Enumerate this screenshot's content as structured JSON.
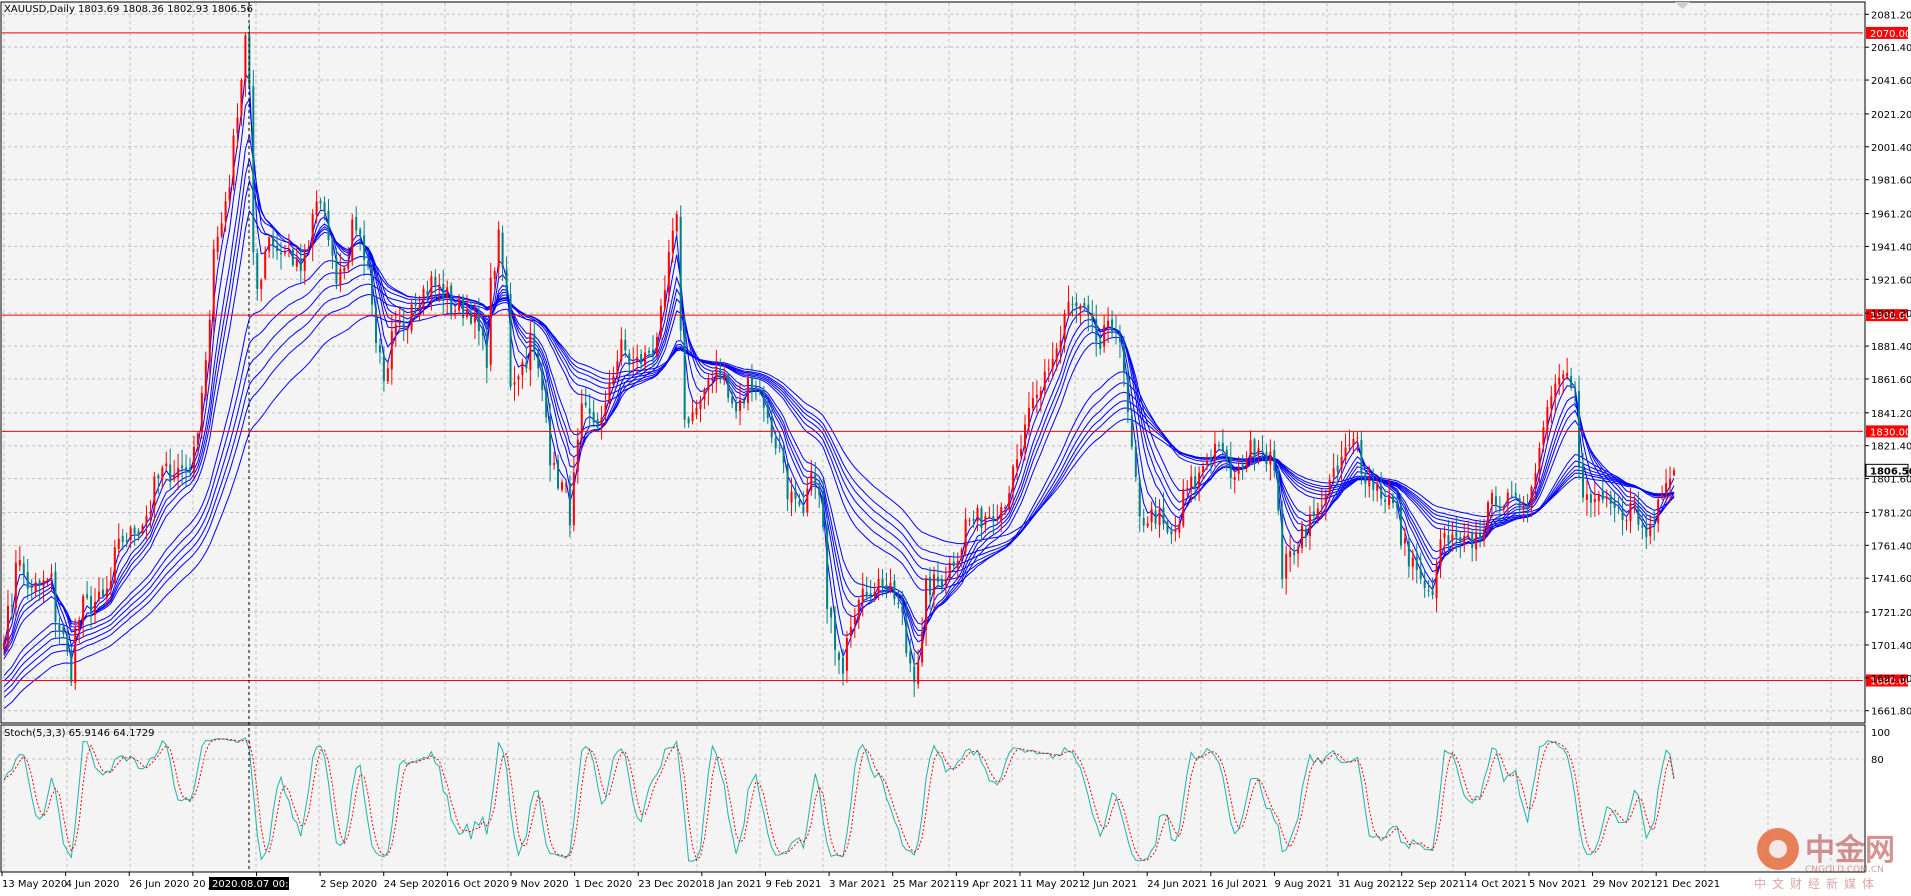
{
  "chart_data": {
    "type": "candlestick",
    "symbol_header": "XAUUSD,Daily  1803.69 1808.36 1802.93 1806.56",
    "ohlc_last": {
      "open": 1803.69,
      "high": 1808.36,
      "low": 1802.93,
      "close": 1806.56
    },
    "current_price_label": "1806.56",
    "price_axis_ticks": [
      "2081.20",
      "2061.40",
      "2041.60",
      "2021.20",
      "2001.40",
      "1981.60",
      "1961.20",
      "1941.40",
      "1921.60",
      "1901.20",
      "1881.40",
      "1861.60",
      "1841.20",
      "1821.40",
      "1801.60",
      "1781.20",
      "1761.40",
      "1741.60",
      "1721.20",
      "1701.40",
      "1681.60",
      "1661.80"
    ],
    "horizontal_levels": [
      {
        "label": "2070.00",
        "value": 2070,
        "color": "#ff0000"
      },
      {
        "label": "1900.00",
        "value": 1900,
        "color": "#ff0000"
      },
      {
        "label": "1830.00",
        "value": 1830,
        "color": "#ff0000"
      },
      {
        "label": "1680.00",
        "value": 1680,
        "color": "#ff0000"
      }
    ],
    "crosshair_date": "2020.08.07 00:00",
    "time_axis_labels": [
      "13 May 2020",
      "4 Jun 2020",
      "26 Jun 2020",
      "20 Jul 2020",
      "",
      "2 Sep 2020",
      "24 Sep 2020",
      "16 Oct 2020",
      "9 Nov 2020",
      "1 Dec 2020",
      "23 Dec 2020",
      "18 Jan 2021",
      "9 Feb 2021",
      "3 Mar 2021",
      "25 Mar 2021",
      "19 Apr 2021",
      "11 May 2021",
      "2 Jun 2021",
      "24 Jun 2021",
      "16 Jul 2021",
      "9 Aug 2021",
      "31 Aug 2021",
      "22 Sep 2021",
      "14 Oct 2021",
      "5 Nov 2021",
      "29 Nov 2021",
      "21 Dec 2021"
    ],
    "y_range": [
      1655,
      2088
    ],
    "up_color": "#ff0000",
    "down_color": "#008080",
    "ma_color": "#0000ff",
    "price_path": [
      [
        "2020-05-13",
        1710
      ],
      [
        "2020-05-18",
        1755
      ],
      [
        "2020-05-22",
        1732
      ],
      [
        "2020-05-29",
        1740
      ],
      [
        "2020-06-03",
        1705
      ],
      [
        "2020-06-05",
        1685
      ],
      [
        "2020-06-10",
        1725
      ],
      [
        "2020-06-17",
        1728
      ],
      [
        "2020-06-24",
        1765
      ],
      [
        "2020-06-30",
        1772
      ],
      [
        "2020-07-08",
        1805
      ],
      [
        "2020-07-16",
        1808
      ],
      [
        "2020-07-20",
        1815
      ],
      [
        "2020-07-24",
        1895
      ],
      [
        "2020-07-29",
        1960
      ],
      [
        "2020-08-04",
        2020
      ],
      [
        "2020-08-06",
        2068
      ],
      [
        "2020-08-11",
        1910
      ],
      [
        "2020-08-14",
        1945
      ],
      [
        "2020-08-20",
        1935
      ],
      [
        "2020-08-26",
        1930
      ],
      [
        "2020-09-01",
        1970
      ],
      [
        "2020-09-08",
        1925
      ],
      [
        "2020-09-15",
        1955
      ],
      [
        "2020-09-21",
        1905
      ],
      [
        "2020-09-24",
        1855
      ],
      [
        "2020-09-28",
        1885
      ],
      [
        "2020-10-05",
        1910
      ],
      [
        "2020-10-12",
        1920
      ],
      [
        "2020-10-19",
        1905
      ],
      [
        "2020-10-26",
        1902
      ],
      [
        "2020-10-30",
        1875
      ],
      [
        "2020-11-04",
        1945
      ],
      [
        "2020-11-09",
        1860
      ],
      [
        "2020-11-16",
        1885
      ],
      [
        "2020-11-24",
        1805
      ],
      [
        "2020-11-30",
        1780
      ],
      [
        "2020-12-03",
        1840
      ],
      [
        "2020-12-10",
        1835
      ],
      [
        "2020-12-17",
        1880
      ],
      [
        "2020-12-22",
        1870
      ],
      [
        "2020-12-29",
        1880
      ],
      [
        "2021-01-06",
        1955
      ],
      [
        "2021-01-08",
        1835
      ],
      [
        "2021-01-14",
        1845
      ],
      [
        "2021-01-20",
        1870
      ],
      [
        "2021-01-27",
        1842
      ],
      [
        "2021-02-02",
        1862
      ],
      [
        "2021-02-08",
        1835
      ],
      [
        "2021-02-15",
        1795
      ],
      [
        "2021-02-19",
        1775
      ],
      [
        "2021-02-24",
        1805
      ],
      [
        "2021-03-01",
        1720
      ],
      [
        "2021-03-05",
        1690
      ],
      [
        "2021-03-10",
        1725
      ],
      [
        "2021-03-15",
        1735
      ],
      [
        "2021-03-19",
        1740
      ],
      [
        "2021-03-24",
        1730
      ],
      [
        "2021-03-31",
        1685
      ],
      [
        "2021-04-05",
        1735
      ],
      [
        "2021-04-12",
        1745
      ],
      [
        "2021-04-19",
        1775
      ],
      [
        "2021-04-26",
        1780
      ],
      [
        "2021-05-03",
        1790
      ],
      [
        "2021-05-10",
        1835
      ],
      [
        "2021-05-17",
        1865
      ],
      [
        "2021-05-25",
        1905
      ],
      [
        "2021-05-31",
        1900
      ],
      [
        "2021-06-04",
        1880
      ],
      [
        "2021-06-10",
        1895
      ],
      [
        "2021-06-14",
        1860
      ],
      [
        "2021-06-18",
        1775
      ],
      [
        "2021-06-24",
        1780
      ],
      [
        "2021-06-30",
        1765
      ],
      [
        "2021-07-06",
        1795
      ],
      [
        "2021-07-12",
        1810
      ],
      [
        "2021-07-16",
        1825
      ],
      [
        "2021-07-22",
        1800
      ],
      [
        "2021-07-30",
        1825
      ],
      [
        "2021-08-04",
        1815
      ],
      [
        "2021-08-09",
        1745
      ],
      [
        "2021-08-13",
        1765
      ],
      [
        "2021-08-20",
        1780
      ],
      [
        "2021-08-27",
        1805
      ],
      [
        "2021-09-03",
        1825
      ],
      [
        "2021-09-08",
        1800
      ],
      [
        "2021-09-15",
        1790
      ],
      [
        "2021-09-22",
        1755
      ],
      [
        "2021-09-29",
        1730
      ],
      [
        "2021-10-04",
        1765
      ],
      [
        "2021-10-11",
        1760
      ],
      [
        "2021-10-18",
        1770
      ],
      [
        "2021-10-22",
        1792
      ],
      [
        "2021-10-29",
        1785
      ],
      [
        "2021-11-03",
        1790
      ],
      [
        "2021-11-08",
        1825
      ],
      [
        "2021-11-12",
        1865
      ],
      [
        "2021-11-16",
        1870
      ],
      [
        "2021-11-19",
        1850
      ],
      [
        "2021-11-23",
        1790
      ],
      [
        "2021-11-30",
        1785
      ],
      [
        "2021-12-06",
        1780
      ],
      [
        "2021-12-10",
        1785
      ],
      [
        "2021-12-15",
        1768
      ],
      [
        "2021-12-20",
        1795
      ],
      [
        "2021-12-24",
        1806.56
      ]
    ],
    "stoch_label": "Stoch(5,3,3) 65.9146 64.1729",
    "stoch_main_last": 65.9146,
    "stoch_signal_last": 64.1729,
    "stoch_levels": [
      100,
      80
    ],
    "stoch_main_color": "#20b2aa",
    "stoch_signal_color": "#ff0000"
  },
  "watermark": {
    "cn": "中金网",
    "en": "CNGOLD.COM.CN",
    "sub": "中文财经新媒体"
  }
}
